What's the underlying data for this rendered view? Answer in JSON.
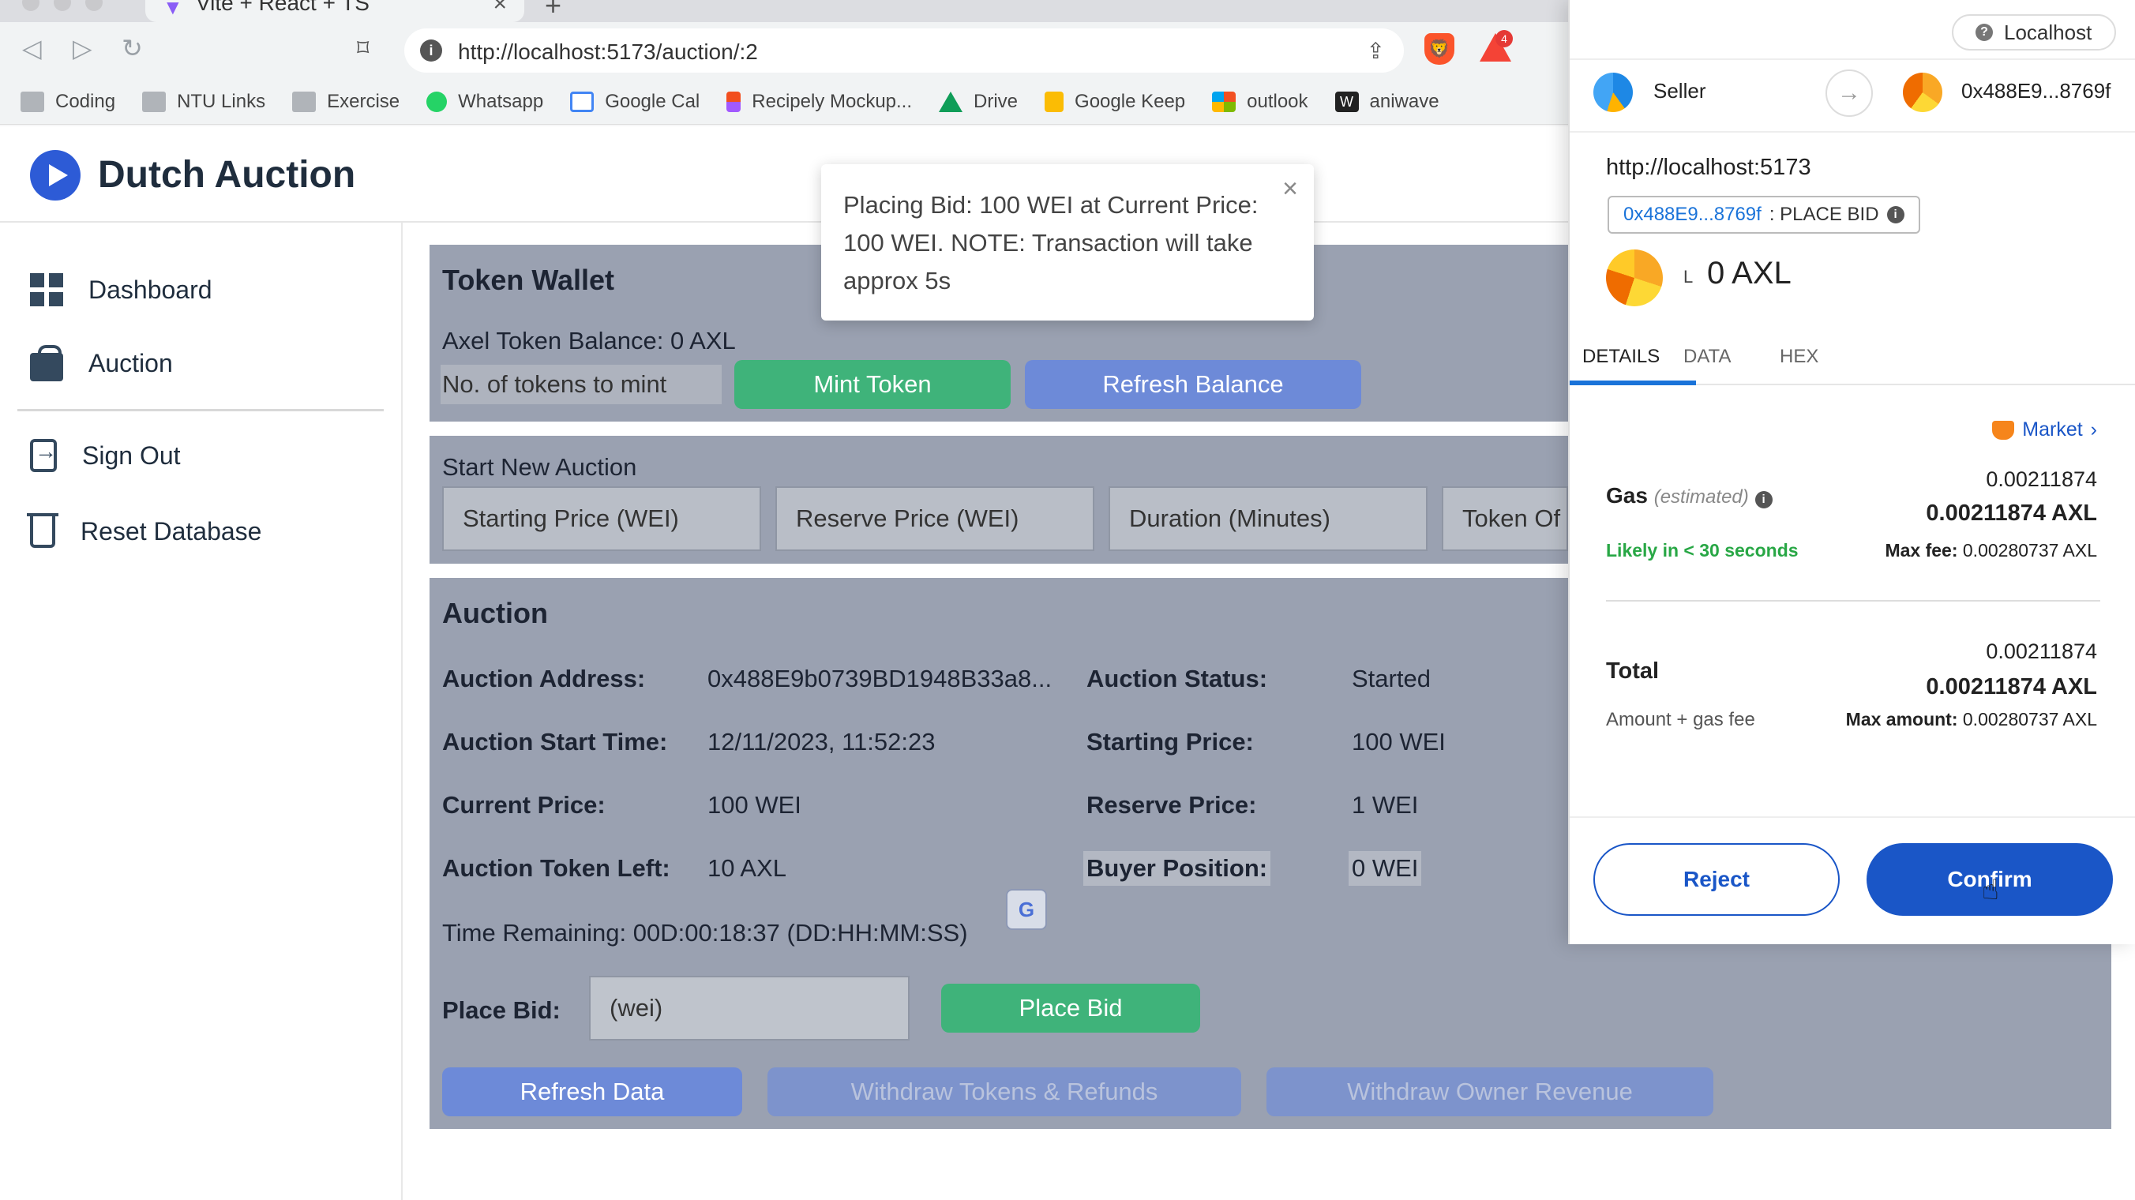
{
  "browser": {
    "tab_title": "Vite + React + TS",
    "url": "http://localhost:5173/auction/:2",
    "brave_shield_icon": "brave-lion-icon",
    "rewards_badge": "4",
    "bookmarks": [
      {
        "label": "Coding",
        "icon": "folder"
      },
      {
        "label": "NTU Links",
        "icon": "folder"
      },
      {
        "label": "Exercise",
        "icon": "folder"
      },
      {
        "label": "Whatsapp",
        "icon": "wa"
      },
      {
        "label": "Google Cal",
        "icon": "gcal"
      },
      {
        "label": "Recipely Mockup...",
        "icon": "figma"
      },
      {
        "label": "Drive",
        "icon": "drive"
      },
      {
        "label": "Google Keep",
        "icon": "keep"
      },
      {
        "label": "outlook",
        "icon": "outlook"
      },
      {
        "label": "aniwave",
        "icon": "w"
      }
    ]
  },
  "app": {
    "title": "Dutch Auction",
    "sidebar": {
      "dashboard": "Dashboard",
      "auction": "Auction",
      "sign_out": "Sign Out",
      "reset_db": "Reset Database"
    },
    "token_wallet": {
      "heading": "Token Wallet",
      "balance": "Axel Token Balance: 0 AXL",
      "mint_placeholder": "No. of tokens to mint",
      "mint_button": "Mint Token",
      "refresh_button": "Refresh Balance"
    },
    "start_auction": {
      "heading": "Start New Auction",
      "starting_price_placeholder": "Starting Price (WEI)",
      "reserve_price_placeholder": "Reserve Price (WEI)",
      "duration_placeholder": "Duration (Minutes)",
      "token_offer_placeholder": "Token Of"
    },
    "auction": {
      "heading": "Auction",
      "address_label": "Auction Address:",
      "address_value": "0x488E9b0739BD1948B33a8...",
      "status_label": "Auction Status:",
      "status_value": "Started",
      "start_time_label": "Auction Start Time:",
      "start_time_value": "12/11/2023, 11:52:23",
      "starting_price_label": "Starting Price:",
      "starting_price_value": "100 WEI",
      "current_price_label": "Current Price:",
      "current_price_value": "100 WEI",
      "reserve_price_label": "Reserve Price:",
      "reserve_price_value": "1 WEI",
      "tokens_left_label": "Auction Token Left:",
      "tokens_left_value": "10 AXL",
      "buyer_position_label": "Buyer Position:",
      "buyer_position_value": "0 WEI",
      "time_remaining": "Time Remaining: 00D:00:18:37 (DD:HH:MM:SS)",
      "place_bid_label": "Place Bid:",
      "bid_placeholder": "(wei)",
      "place_bid_button": "Place Bid",
      "refresh_data_button": "Refresh Data",
      "withdraw_tokens_button": "Withdraw Tokens & Refunds",
      "withdraw_revenue_button": "Withdraw Owner Revenue"
    },
    "toast": {
      "message": "Placing Bid: 100 WEI at Current Price: 100 WEI. NOTE: Transaction will take approx 5s"
    }
  },
  "metamask": {
    "network": "Localhost",
    "from": "Seller",
    "to": "0x488E9...8769f",
    "origin": "http://localhost:5173",
    "method_addr": "0x488E9...8769f",
    "method_name": ": PLACE BID",
    "amount": "0 AXL",
    "amount_prefix": "L",
    "tabs": [
      "DETAILS",
      "DATA",
      "HEX"
    ],
    "market": "Market",
    "gas_label": "Gas",
    "gas_estimated": "(estimated)",
    "gas_value": "0.00211874",
    "gas_value_bold": "0.00211874 AXL",
    "likely": "Likely in < 30 seconds",
    "max_fee_label": "Max fee:",
    "max_fee_value": "0.00280737 AXL",
    "total_label": "Total",
    "total_value": "0.00211874",
    "total_value_bold": "0.00211874 AXL",
    "amount_gas_fee": "Amount + gas fee",
    "max_amount_label": "Max amount:",
    "max_amount_value": "0.00280737 AXL",
    "reject": "Reject",
    "confirm": "Confirm"
  }
}
